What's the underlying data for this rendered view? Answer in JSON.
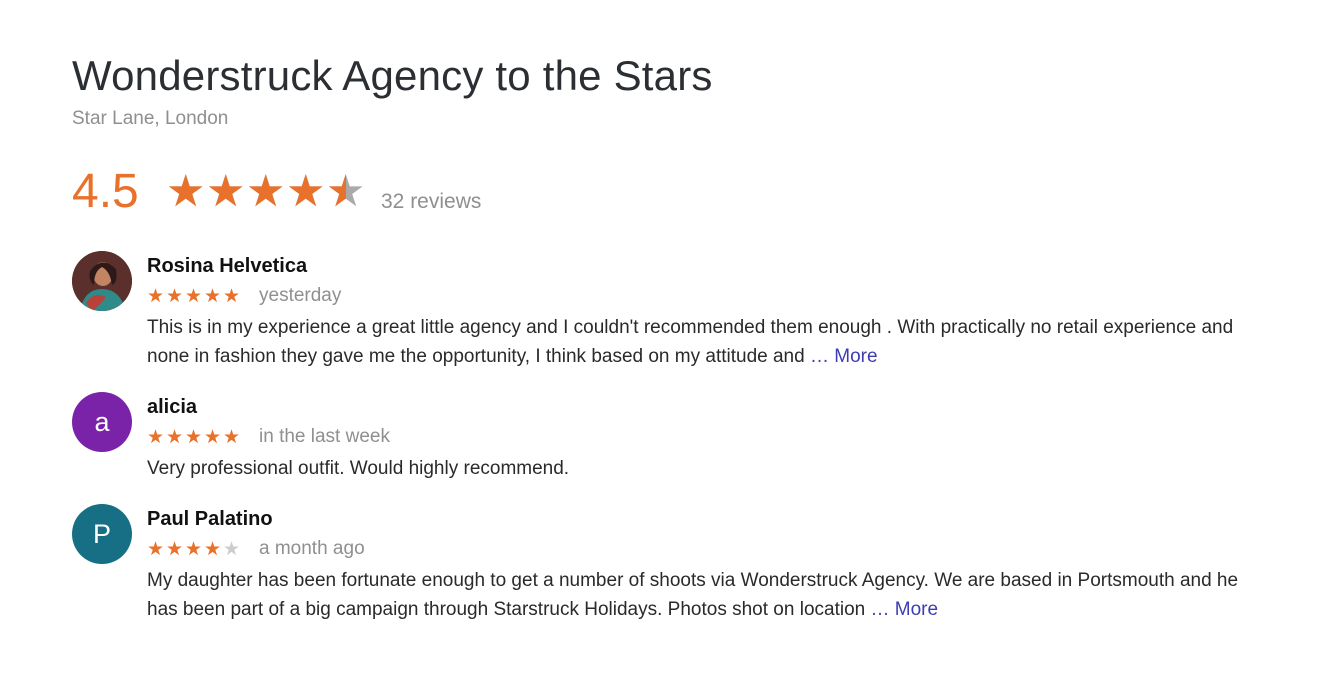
{
  "business": {
    "name": "Wonderstruck Agency to the Stars",
    "address": "Star Lane, London"
  },
  "rating": {
    "value": "4.5",
    "stars": 4.5,
    "reviews_label": "32 reviews",
    "accent_color": "#e8712b"
  },
  "reviews": [
    {
      "name": "Rosina Helvetica",
      "avatar": {
        "type": "photo",
        "icon": "user-photo"
      },
      "stars": 5,
      "when": "yesterday",
      "text": "This is in my experience a great little agency and I couldn't recommended them enough . With practically no retail experience and none in fashion they gave me the opportunity, I think based on my attitude and",
      "more": "… More"
    },
    {
      "name": "alicia",
      "avatar": {
        "type": "letter",
        "letter": "a",
        "color": "#7b23a8"
      },
      "stars": 5,
      "when": "in the last week",
      "text": "Very professional outfit. Would highly recommend.",
      "more": ""
    },
    {
      "name": "Paul Palatino",
      "avatar": {
        "type": "letter",
        "letter": "P",
        "color": "#176f85"
      },
      "stars": 4,
      "when": "a month ago",
      "text": "My daughter has been fortunate enough to get a number of shoots via Wonderstruck Agency. We are based in Portsmouth and he has been part of a big campaign through Starstruck Holidays. Photos shot on location",
      "more": "… More"
    }
  ]
}
